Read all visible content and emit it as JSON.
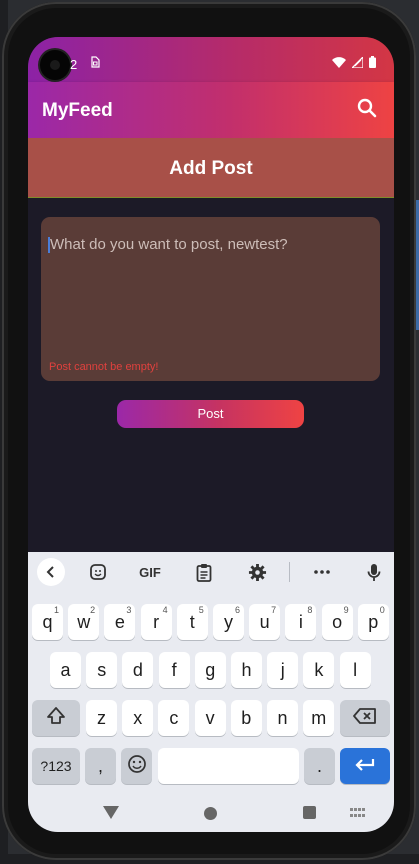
{
  "status_bar": {
    "time": "2",
    "sim_icon": "sim-card-icon",
    "icons": [
      "wifi-icon",
      "signal-icon",
      "battery-icon"
    ]
  },
  "app_bar": {
    "title": "MyFeed",
    "search_icon": "search-icon"
  },
  "page": {
    "title": "Add Post"
  },
  "post_form": {
    "placeholder": "What do you want to post, newtest?",
    "error": "Post cannot be empty!",
    "submit_label": "Post"
  },
  "keyboard": {
    "toolbar": {
      "back_icon": "chevron-left-icon",
      "sticker_icon": "sticker-icon",
      "gif_label": "GIF",
      "clipboard_icon": "clipboard-icon",
      "settings_icon": "gear-icon",
      "more_icon": "more-icon",
      "mic_icon": "mic-icon"
    },
    "row1": [
      {
        "k": "q",
        "h": "1"
      },
      {
        "k": "w",
        "h": "2"
      },
      {
        "k": "e",
        "h": "3"
      },
      {
        "k": "r",
        "h": "4"
      },
      {
        "k": "t",
        "h": "5"
      },
      {
        "k": "y",
        "h": "6"
      },
      {
        "k": "u",
        "h": "7"
      },
      {
        "k": "i",
        "h": "8"
      },
      {
        "k": "o",
        "h": "9"
      },
      {
        "k": "p",
        "h": "0"
      }
    ],
    "row2": [
      "a",
      "s",
      "d",
      "f",
      "g",
      "h",
      "j",
      "k",
      "l"
    ],
    "row3": [
      "z",
      "x",
      "c",
      "v",
      "b",
      "n",
      "m"
    ],
    "symbols_label": "?123",
    "comma_label": ",",
    "period_label": ".",
    "emoji_icon": "emoji-icon",
    "shift_icon": "shift-icon",
    "backspace_icon": "backspace-icon",
    "enter_icon": "enter-icon"
  },
  "nav_bar": {
    "back": "back-triangle-icon",
    "home": "home-circle-icon",
    "recents": "recents-square-icon",
    "kbd": "keyboard-icon"
  },
  "colors": {
    "accent_start": "#9b28a8",
    "accent_end": "#ef4343",
    "error": "#e0413e",
    "background": "#1c1a27",
    "header_band": "#a85048",
    "post_box": "#5a3c37"
  }
}
